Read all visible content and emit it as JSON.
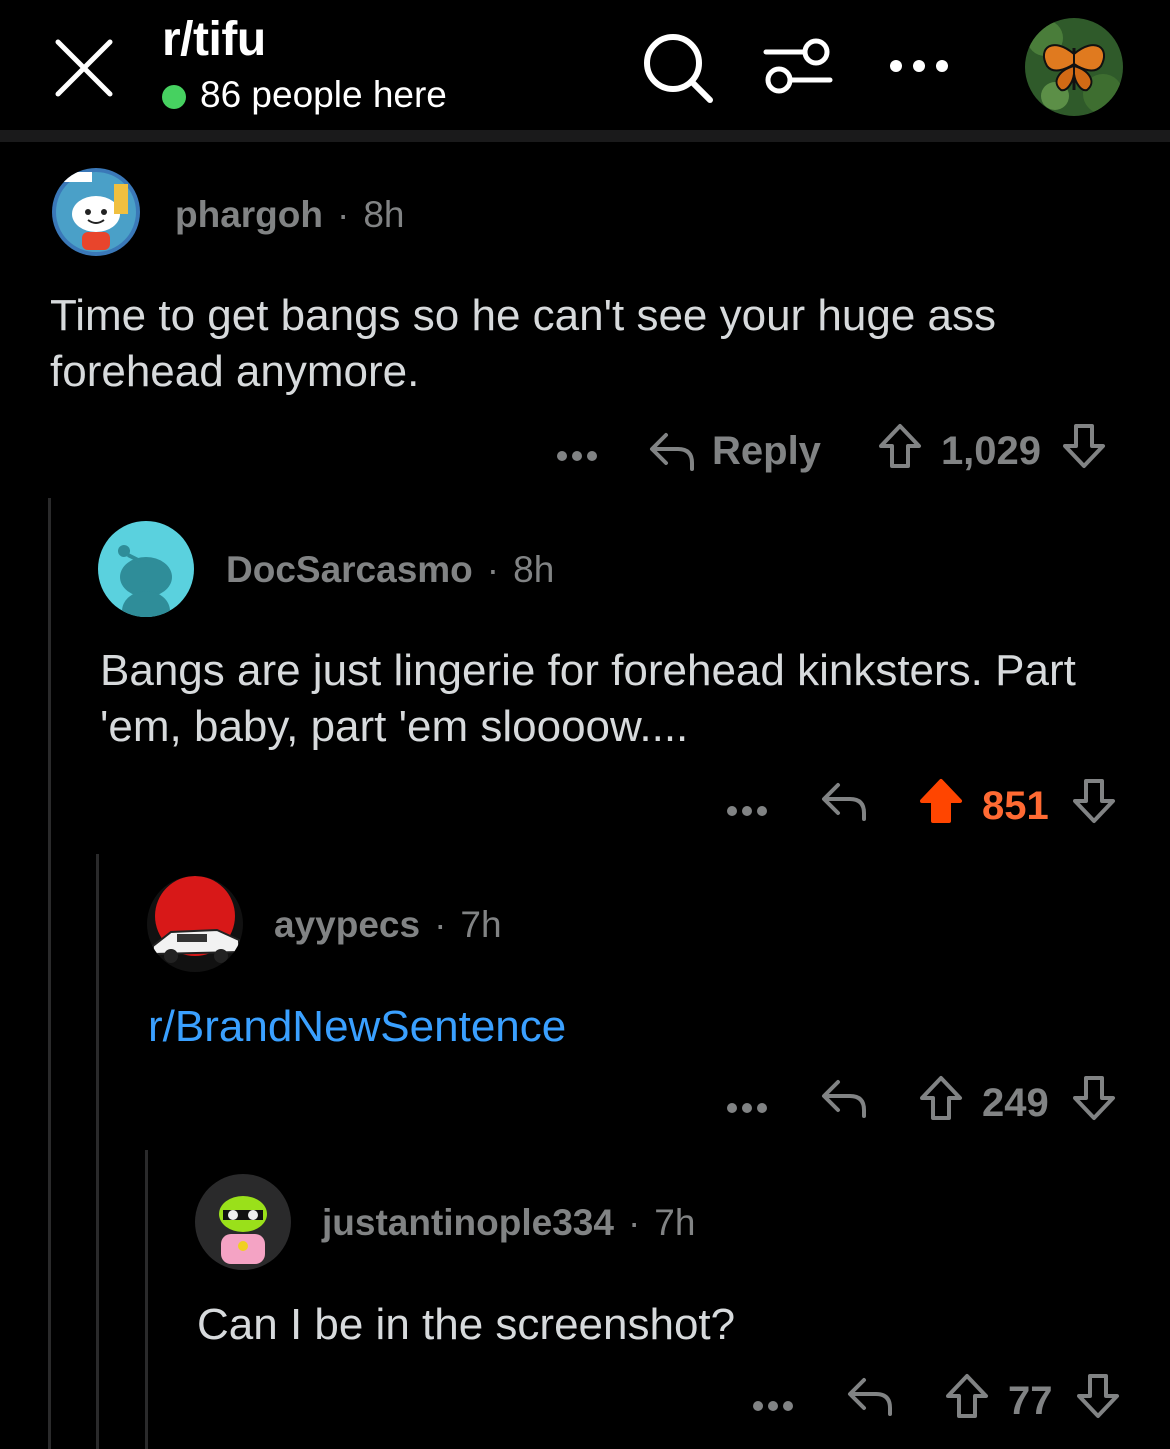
{
  "header": {
    "subreddit": "r/tifu",
    "online_count": "86 people here",
    "icons": [
      "close-icon",
      "search-icon",
      "filter-icon",
      "more-icon",
      "user-avatar"
    ]
  },
  "comments": [
    {
      "author": "phargoh",
      "age": "8h",
      "text": "Time to get bangs so he can't see your huge ass forehead anymore.",
      "reply_label": "Reply",
      "score": "1,029",
      "upvoted": false
    },
    {
      "author": "DocSarcasmo",
      "age": "8h",
      "text": "Bangs are just lingerie for forehead kinksters. Part 'em, baby, part 'em sloooow....",
      "score": "851",
      "upvoted": true
    },
    {
      "author": "ayypecs",
      "age": "7h",
      "text": "r/BrandNewSentence",
      "score": "249",
      "upvoted": false
    },
    {
      "author": "justantinople334",
      "age": "7h",
      "text": "Can I be in the screenshot?",
      "score": "77",
      "upvoted": false
    }
  ],
  "colors": {
    "background": "#000000",
    "text": "#d7dadc",
    "meta": "#818384",
    "link": "#3aa0ff",
    "upvote": "#ff6a33",
    "online": "#46d160"
  }
}
